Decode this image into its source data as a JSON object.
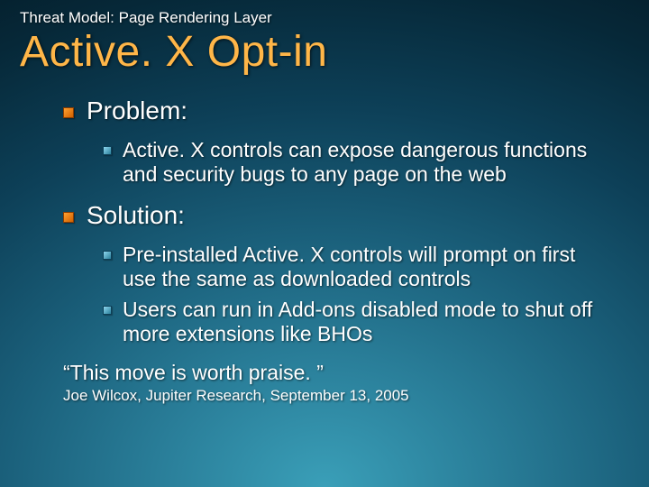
{
  "eyebrow": "Threat Model: Page Rendering Layer",
  "title": "Active. X Opt-in",
  "sections": [
    {
      "heading": "Problem:",
      "items": [
        "Active. X controls can expose dangerous functions and security bugs to any page on the web"
      ]
    },
    {
      "heading": "Solution:",
      "items": [
        "Pre-installed Active. X controls will prompt on first use the same as downloaded controls",
        "Users can run in Add-ons disabled mode to shut off more extensions like BHOs"
      ]
    }
  ],
  "quote": "“This move is worth praise. ”",
  "attribution": "Joe Wilcox, Jupiter Research, September 13, 2005"
}
